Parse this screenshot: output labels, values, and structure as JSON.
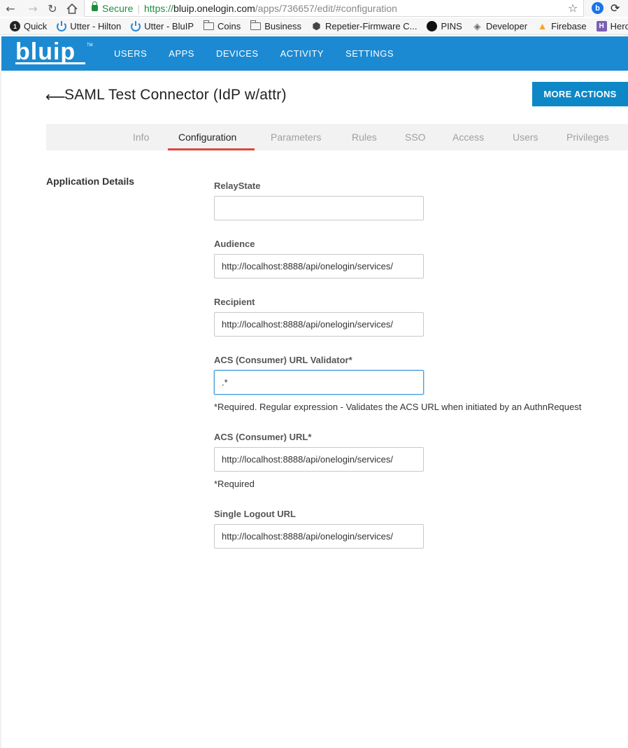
{
  "browser": {
    "url_secure_label": "Secure",
    "url_scheme": "https://",
    "url_host": "bluip.onelogin.com",
    "url_path": "/apps/736657/edit/#configuration",
    "extension_1_letter": "b"
  },
  "bookmarks": [
    {
      "label": "Quick",
      "icon": "dark-circle-icon",
      "icon_text": "1"
    },
    {
      "label": "Utter - Hilton",
      "icon": "power-icon"
    },
    {
      "label": "Utter - BluIP",
      "icon": "power-icon"
    },
    {
      "label": "Coins",
      "icon": "folder-icon"
    },
    {
      "label": "Business",
      "icon": "folder-icon"
    },
    {
      "label": "Repetier-Firmware C...",
      "icon": "hexagon-icon"
    },
    {
      "label": "PINS",
      "icon": "github-icon"
    },
    {
      "label": "Developer",
      "icon": "developer-icon"
    },
    {
      "label": "Firebase",
      "icon": "firebase-icon"
    },
    {
      "label": "Heroku",
      "icon": "heroku-icon",
      "icon_text": "H"
    }
  ],
  "header": {
    "logo_text": "bluip",
    "logo_tm": "TM",
    "nav": [
      "USERS",
      "APPS",
      "DEVICES",
      "ACTIVITY",
      "SETTINGS"
    ],
    "brand_color": "#1c8ad2"
  },
  "page": {
    "title": "SAML Test Connector (IdP w/attr)",
    "more_actions": "MORE ACTIONS"
  },
  "tabs": {
    "items": [
      "Info",
      "Configuration",
      "Parameters",
      "Rules",
      "SSO",
      "Access",
      "Users",
      "Privileges"
    ],
    "active": "Configuration",
    "active_color": "#e2453c"
  },
  "form": {
    "section": "Application Details",
    "fields": [
      {
        "label": "RelayState",
        "value": ""
      },
      {
        "label": "Audience",
        "value": "http://localhost:8888/api/onelogin/services/"
      },
      {
        "label": "Recipient",
        "value": "http://localhost:8888/api/onelogin/services/"
      },
      {
        "label": "ACS (Consumer) URL Validator*",
        "value": ".*",
        "help": "*Required. Regular expression - Validates the ACS URL when initiated by an AuthnRequest"
      },
      {
        "label": "ACS (Consumer) URL*",
        "value": "http://localhost:8888/api/onelogin/services/",
        "help": "*Required"
      },
      {
        "label": "Single Logout URL",
        "value": "http://localhost:8888/api/onelogin/services/"
      }
    ]
  }
}
